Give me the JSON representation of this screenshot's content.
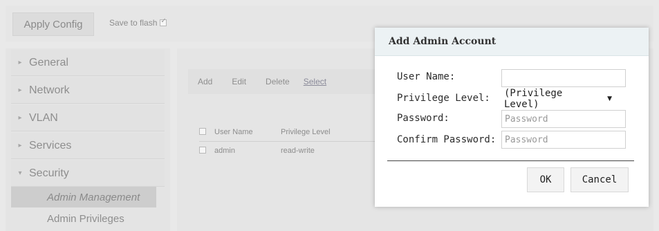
{
  "topbar": {
    "apply_label": "Apply Config",
    "save_label": "Save to flash"
  },
  "sidebar": {
    "items": [
      {
        "label": "General",
        "caret": "▸"
      },
      {
        "label": "Network",
        "caret": "▸"
      },
      {
        "label": "VLAN",
        "caret": "▸"
      },
      {
        "label": "Services",
        "caret": "▸"
      },
      {
        "label": "Security",
        "caret": "▾"
      }
    ],
    "subitems": [
      {
        "label": "Admin Management"
      },
      {
        "label": "Admin Privileges"
      }
    ]
  },
  "toolbar": {
    "add": "Add",
    "edit": "Edit",
    "delete": "Delete",
    "select": "Select"
  },
  "table": {
    "columns": [
      "User Name",
      "Privilege Level"
    ],
    "rows": [
      {
        "user": "admin",
        "privilege": "read-write"
      }
    ]
  },
  "dialog": {
    "title": "Add Admin Account",
    "username_label": "User Name:",
    "privilege_label": "Privilege Level:",
    "privilege_value": "(Privilege Level)",
    "password_label": "Password:",
    "password_placeholder": "Password",
    "confirm_label": "Confirm Password:",
    "confirm_placeholder": "Password",
    "ok": "OK",
    "cancel": "Cancel"
  }
}
